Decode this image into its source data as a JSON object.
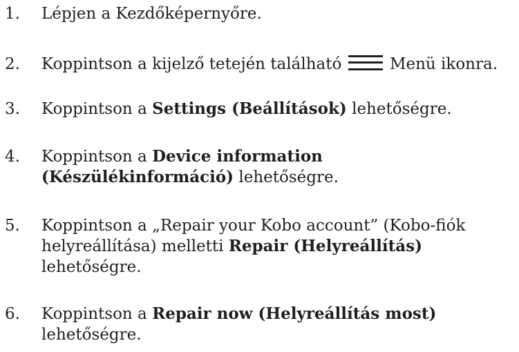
{
  "steps": [
    {
      "number": "1.",
      "lines": [
        [
          "Lépjen a Kezdőképernyőre."
        ]
      ]
    },
    {
      "number": "2.",
      "parts": {
        "before": "Koppintson a kijelző tetején található",
        "icon": "menu-icon",
        "after": "Menü ikonra."
      }
    },
    {
      "number": "3.",
      "parts": {
        "before": "Koppintson a ",
        "bold": "Settings (Beállítások)",
        "after": " lehetőségre."
      }
    },
    {
      "number": "4.",
      "lines": [
        {
          "before": "Koppintson  a ",
          "bold": "Device information"
        },
        {
          "bold": "(Készülékinformáció)",
          "after": " lehetőségre."
        }
      ]
    },
    {
      "number": "5.",
      "lines": [
        {
          "text": "Koppintson a „Repair your Kobo account” (Kobo-fiók"
        },
        {
          "before": "helyreállítása) melletti ",
          "bold": "Repair (Helyreállítás)"
        },
        {
          "text": "lehetőségre."
        }
      ]
    },
    {
      "number": "6.",
      "lines": [
        {
          "before": "Koppintson  a ",
          "bold": "Repair now (Helyreállítás most)"
        },
        {
          "text": "lehetőségre."
        }
      ]
    }
  ]
}
